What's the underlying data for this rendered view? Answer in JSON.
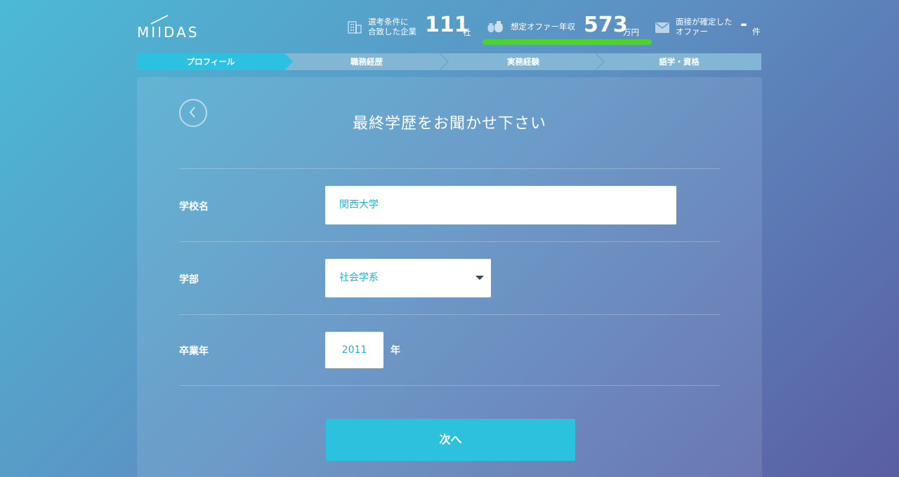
{
  "brand": {
    "logo_text": "MIIDAS"
  },
  "stats": {
    "matched_companies": {
      "label_line1": "選考条件に",
      "label_line2": "合致した企業",
      "value": "111",
      "unit": "社"
    },
    "offer_salary": {
      "label": "想定オファー年収",
      "value": "573",
      "unit": "万円"
    },
    "confirmed_offers": {
      "label_line1": "面接が確定した",
      "label_line2": "オファー",
      "value": "-",
      "unit": "件"
    }
  },
  "steps": [
    {
      "label": "プロフィール",
      "active": true
    },
    {
      "label": "職務経歴",
      "active": false
    },
    {
      "label": "実務経験",
      "active": false
    },
    {
      "label": "語学・資格",
      "active": false
    }
  ],
  "form": {
    "title": "最終学歴をお聞かせ下さい",
    "school": {
      "label": "学校名",
      "value": "関西大学"
    },
    "faculty": {
      "label": "学部",
      "value": "社会学系"
    },
    "graduation": {
      "label": "卒業年",
      "value": "2011",
      "suffix": "年"
    },
    "next_label": "次へ"
  },
  "colors": {
    "accent": "#2cc1dd",
    "progress_green": "#4ed32a",
    "input_text": "#24b2d2"
  }
}
